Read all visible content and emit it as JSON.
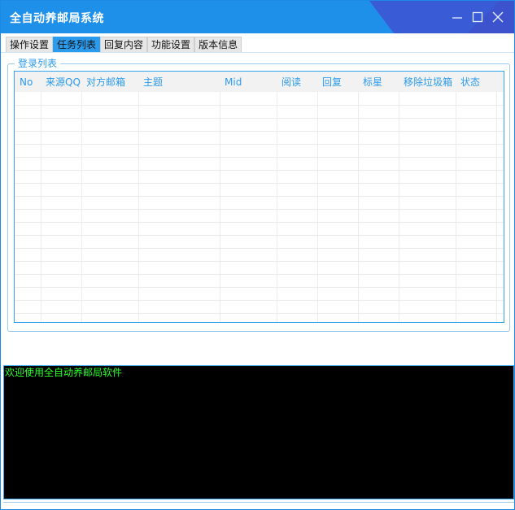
{
  "window": {
    "title": "全自动养邮局系统",
    "controls": [
      "minimize-icon",
      "maximize-icon",
      "close-icon"
    ]
  },
  "tabs": [
    {
      "label": "操作设置",
      "active": false
    },
    {
      "label": "任务列表",
      "active": true
    },
    {
      "label": "回复内容",
      "active": false
    },
    {
      "label": "功能设置",
      "active": false
    },
    {
      "label": "版本信息",
      "active": false
    }
  ],
  "group": {
    "legend": "登录列表"
  },
  "table": {
    "columns": [
      "No",
      "来源QQ",
      "对方邮箱",
      "主题",
      "Mid",
      "阅读",
      "回复",
      "标星",
      "移除垃圾箱",
      "状态"
    ],
    "rows": []
  },
  "console": {
    "log": "欢迎使用全自动养邮局软件"
  },
  "colors": {
    "titlebar": "#1e90ea",
    "accent": "#2b9bee",
    "console_bg": "#000000",
    "console_text": "#2bff2b"
  }
}
